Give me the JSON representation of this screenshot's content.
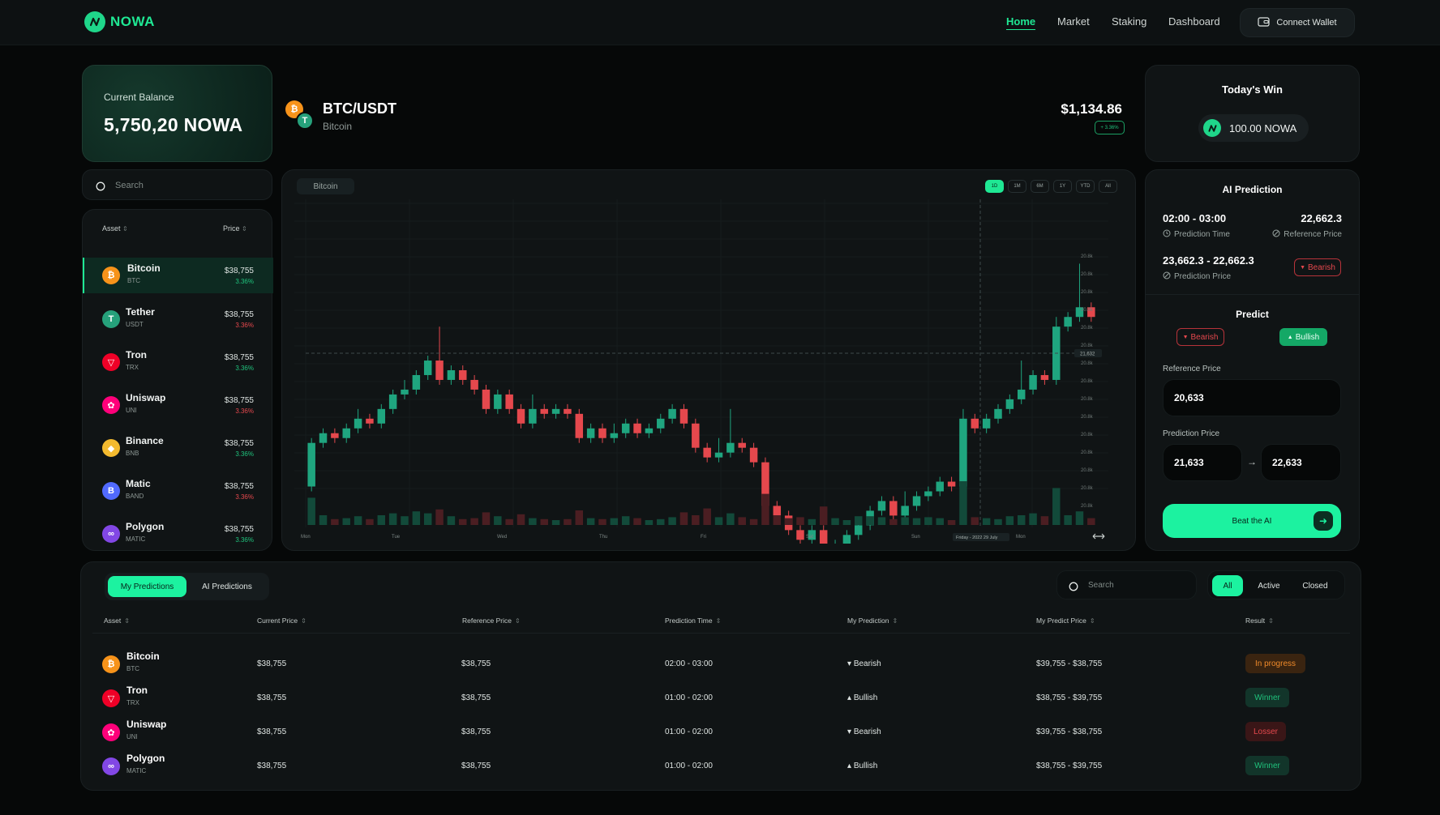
{
  "nav": {
    "brand": "NOWA",
    "links": [
      "Home",
      "Market",
      "Staking",
      "Dashboard"
    ],
    "wallet_label": "Connect Wallet"
  },
  "balance": {
    "label": "Current Balance",
    "value": "5,750,20 NOWA"
  },
  "search": {
    "placeholder": "Search"
  },
  "asset_list": {
    "headers": [
      "Asset",
      "Price"
    ],
    "items": [
      {
        "name": "Bitcoin",
        "symbol": "BTC",
        "price": "$38,755",
        "change": "3.36%",
        "dir": "up",
        "color": "#f7931a",
        "glyph": "₿"
      },
      {
        "name": "Tether",
        "symbol": "USDT",
        "price": "$38,755",
        "change": "3.36%",
        "dir": "down",
        "color": "#26a17b",
        "glyph": "T"
      },
      {
        "name": "Tron",
        "symbol": "TRX",
        "price": "$38,755",
        "change": "3.36%",
        "dir": "up",
        "color": "#ef0027",
        "glyph": "▽"
      },
      {
        "name": "Uniswap",
        "symbol": "UNI",
        "price": "$38,755",
        "change": "3.36%",
        "dir": "down",
        "color": "#ff007a",
        "glyph": "✿"
      },
      {
        "name": "Binance",
        "symbol": "BNB",
        "price": "$38,755",
        "change": "3.36%",
        "dir": "up",
        "color": "#f3ba2f",
        "glyph": "◆"
      },
      {
        "name": "Matic",
        "symbol": "BAND",
        "price": "$38,755",
        "change": "3.36%",
        "dir": "down",
        "color": "#516aff",
        "glyph": "B"
      },
      {
        "name": "Polygon",
        "symbol": "MATIC",
        "price": "$38,755",
        "change": "3.36%",
        "dir": "up",
        "color": "#8247e5",
        "glyph": "∞"
      }
    ]
  },
  "pair": {
    "title": "BTC/USDT",
    "subtitle": "Bitcoin",
    "price": "$1,134.86",
    "change": "+ 3.36%"
  },
  "chart_card": {
    "tag": "Bitcoin",
    "ranges": [
      "1D",
      "1M",
      "6M",
      "1Y",
      "YTD",
      "All"
    ],
    "active_range": "1D"
  },
  "chart_data": {
    "type": "candlestick",
    "x_labels": [
      "Mon",
      "Tue",
      "Wed",
      "Thu",
      "Fri",
      "Sat",
      "Sun",
      "Mon"
    ],
    "y_tick_label": "20.8k",
    "y_tick_count": 15,
    "crosshair_value": "21,632",
    "crosshair_time": "Friday - 2022 29 July",
    "ylim": [
      0,
      100
    ],
    "candles": [
      {
        "o": 26,
        "c": 35,
        "h": 36,
        "l": 25,
        "v": 28
      },
      {
        "o": 35,
        "c": 37,
        "h": 38,
        "l": 34,
        "v": 10
      },
      {
        "o": 37,
        "c": 36,
        "h": 38,
        "l": 35,
        "v": 6
      },
      {
        "o": 36,
        "c": 38,
        "h": 39,
        "l": 35,
        "v": 7
      },
      {
        "o": 38,
        "c": 40,
        "h": 42,
        "l": 37,
        "v": 9
      },
      {
        "o": 40,
        "c": 39,
        "h": 41,
        "l": 38,
        "v": 6
      },
      {
        "o": 39,
        "c": 42,
        "h": 43,
        "l": 38,
        "v": 10
      },
      {
        "o": 42,
        "c": 45,
        "h": 46,
        "l": 41,
        "v": 12
      },
      {
        "o": 45,
        "c": 46,
        "h": 48,
        "l": 44,
        "v": 9
      },
      {
        "o": 46,
        "c": 49,
        "h": 50,
        "l": 45,
        "v": 14
      },
      {
        "o": 49,
        "c": 52,
        "h": 53,
        "l": 48,
        "v": 12
      },
      {
        "o": 52,
        "c": 48,
        "h": 59,
        "l": 47,
        "v": 16
      },
      {
        "o": 48,
        "c": 50,
        "h": 51,
        "l": 47,
        "v": 9
      },
      {
        "o": 50,
        "c": 48,
        "h": 51,
        "l": 47,
        "v": 6
      },
      {
        "o": 48,
        "c": 46,
        "h": 49,
        "l": 45,
        "v": 7
      },
      {
        "o": 46,
        "c": 42,
        "h": 47,
        "l": 41,
        "v": 13
      },
      {
        "o": 42,
        "c": 45,
        "h": 46,
        "l": 41,
        "v": 9
      },
      {
        "o": 45,
        "c": 42,
        "h": 46,
        "l": 41,
        "v": 6
      },
      {
        "o": 42,
        "c": 39,
        "h": 43,
        "l": 38,
        "v": 11
      },
      {
        "o": 39,
        "c": 42,
        "h": 45,
        "l": 38,
        "v": 7
      },
      {
        "o": 42,
        "c": 41,
        "h": 43,
        "l": 40,
        "v": 6
      },
      {
        "o": 41,
        "c": 42,
        "h": 43,
        "l": 40,
        "v": 5
      },
      {
        "o": 42,
        "c": 41,
        "h": 43,
        "l": 40,
        "v": 6
      },
      {
        "o": 41,
        "c": 36,
        "h": 42,
        "l": 35,
        "v": 15
      },
      {
        "o": 36,
        "c": 38,
        "h": 39,
        "l": 35,
        "v": 7
      },
      {
        "o": 38,
        "c": 36,
        "h": 39,
        "l": 35,
        "v": 6
      },
      {
        "o": 36,
        "c": 37,
        "h": 39,
        "l": 35,
        "v": 7
      },
      {
        "o": 37,
        "c": 39,
        "h": 40,
        "l": 36,
        "v": 9
      },
      {
        "o": 39,
        "c": 37,
        "h": 40,
        "l": 36,
        "v": 7
      },
      {
        "o": 37,
        "c": 38,
        "h": 39,
        "l": 36,
        "v": 5
      },
      {
        "o": 38,
        "c": 40,
        "h": 41,
        "l": 37,
        "v": 6
      },
      {
        "o": 40,
        "c": 42,
        "h": 43,
        "l": 39,
        "v": 8
      },
      {
        "o": 42,
        "c": 39,
        "h": 43,
        "l": 38,
        "v": 13
      },
      {
        "o": 39,
        "c": 34,
        "h": 40,
        "l": 33,
        "v": 10
      },
      {
        "o": 34,
        "c": 32,
        "h": 35,
        "l": 31,
        "v": 17
      },
      {
        "o": 32,
        "c": 33,
        "h": 36,
        "l": 31,
        "v": 8
      },
      {
        "o": 33,
        "c": 35,
        "h": 42,
        "l": 32,
        "v": 12
      },
      {
        "o": 35,
        "c": 34,
        "h": 36,
        "l": 33,
        "v": 8
      },
      {
        "o": 34,
        "c": 31,
        "h": 35,
        "l": 30,
        "v": 6
      },
      {
        "o": 31,
        "c": 22,
        "h": 32,
        "l": 21,
        "v": 32
      },
      {
        "o": 22,
        "c": 20,
        "h": 23,
        "l": 19,
        "v": 10
      },
      {
        "o": 20,
        "c": 17,
        "h": 21,
        "l": 16,
        "v": 7
      },
      {
        "o": 17,
        "c": 15,
        "h": 18,
        "l": 14,
        "v": 8
      },
      {
        "o": 15,
        "c": 17,
        "h": 18,
        "l": 14,
        "v": 6
      },
      {
        "o": 17,
        "c": 12,
        "h": 18,
        "l": 6,
        "v": 19
      },
      {
        "o": 12,
        "c": 14,
        "h": 15,
        "l": 11,
        "v": 7
      },
      {
        "o": 14,
        "c": 16,
        "h": 17,
        "l": 13,
        "v": 5
      },
      {
        "o": 16,
        "c": 18,
        "h": 19,
        "l": 15,
        "v": 9
      },
      {
        "o": 18,
        "c": 21,
        "h": 22,
        "l": 17,
        "v": 9
      },
      {
        "o": 21,
        "c": 23,
        "h": 24,
        "l": 20,
        "v": 8
      },
      {
        "o": 23,
        "c": 20,
        "h": 24,
        "l": 19,
        "v": 6
      },
      {
        "o": 20,
        "c": 22,
        "h": 25,
        "l": 19,
        "v": 8
      },
      {
        "o": 22,
        "c": 24,
        "h": 25,
        "l": 21,
        "v": 7
      },
      {
        "o": 24,
        "c": 25,
        "h": 26,
        "l": 23,
        "v": 8
      },
      {
        "o": 25,
        "c": 27,
        "h": 28,
        "l": 24,
        "v": 7
      },
      {
        "o": 27,
        "c": 26,
        "h": 28,
        "l": 25,
        "v": 5
      },
      {
        "o": 26,
        "c": 40,
        "h": 42,
        "l": 25,
        "v": 45
      },
      {
        "o": 40,
        "c": 38,
        "h": 41,
        "l": 37,
        "v": 8
      },
      {
        "o": 38,
        "c": 40,
        "h": 41,
        "l": 37,
        "v": 7
      },
      {
        "o": 40,
        "c": 42,
        "h": 43,
        "l": 39,
        "v": 6
      },
      {
        "o": 42,
        "c": 44,
        "h": 45,
        "l": 41,
        "v": 9
      },
      {
        "o": 44,
        "c": 46,
        "h": 52,
        "l": 43,
        "v": 10
      },
      {
        "o": 46,
        "c": 49,
        "h": 50,
        "l": 45,
        "v": 12
      },
      {
        "o": 49,
        "c": 48,
        "h": 50,
        "l": 47,
        "v": 9
      },
      {
        "o": 48,
        "c": 59,
        "h": 61,
        "l": 47,
        "v": 38
      },
      {
        "o": 59,
        "c": 61,
        "h": 62,
        "l": 58,
        "v": 10
      },
      {
        "o": 61,
        "c": 63,
        "h": 72,
        "l": 60,
        "v": 14
      },
      {
        "o": 63,
        "c": 61,
        "h": 64,
        "l": 60,
        "v": 7
      }
    ]
  },
  "today_win": {
    "title": "Today's Win",
    "value": "100.00 NOWA"
  },
  "ai_prediction": {
    "title": "AI Prediction",
    "time": "02:00 - 03:00",
    "time_label": "Prediction Time",
    "ref_value": "22,662.3",
    "ref_label": "Reference Price",
    "range": "23,662.3 - 22,662.3",
    "range_label": "Prediction Price",
    "direction": "Bearish"
  },
  "predict": {
    "title": "Predict",
    "bearish": "Bearish",
    "bullish": "Bullish",
    "ref_label": "Reference Price",
    "ref_value": "20,633",
    "pred_label": "Prediction Price",
    "pred_from": "21,633",
    "pred_to": "22,633",
    "cta": "Beat the AI"
  },
  "predictions_table": {
    "tabs": [
      "My Predictions",
      "AI Predictions"
    ],
    "search_placeholder": "Search",
    "filters": [
      "All",
      "Active",
      "Closed"
    ],
    "headers": [
      "Asset",
      "Current Price",
      "Reference Price",
      "Prediction Time",
      "My Prediction",
      "My Predict Price",
      "Result"
    ],
    "rows": [
      {
        "name": "Bitcoin",
        "symbol": "BTC",
        "color": "#f7931a",
        "glyph": "₿",
        "current": "$38,755",
        "reference": "$38,755",
        "time": "02:00 - 03:00",
        "prediction": "Bearish",
        "dir": "down",
        "range": "$39,755 - $38,755",
        "result": "In progress",
        "status": "prog"
      },
      {
        "name": "Tron",
        "symbol": "TRX",
        "color": "#ef0027",
        "glyph": "▽",
        "current": "$38,755",
        "reference": "$38,755",
        "time": "01:00 - 02:00",
        "prediction": "Bullish",
        "dir": "up",
        "range": "$38,755 - $39,755",
        "result": "Winner",
        "status": "win"
      },
      {
        "name": "Uniswap",
        "symbol": "UNI",
        "color": "#ff007a",
        "glyph": "✿",
        "current": "$38,755",
        "reference": "$38,755",
        "time": "01:00 - 02:00",
        "prediction": "Bearish",
        "dir": "down",
        "range": "$39,755 - $38,755",
        "result": "Losser",
        "status": "lose"
      },
      {
        "name": "Polygon",
        "symbol": "MATIC",
        "color": "#8247e5",
        "glyph": "∞",
        "current": "$38,755",
        "reference": "$38,755",
        "time": "01:00 - 02:00",
        "prediction": "Bullish",
        "dir": "up",
        "range": "$38,755 - $39,755",
        "result": "Winner",
        "status": "win"
      }
    ]
  }
}
